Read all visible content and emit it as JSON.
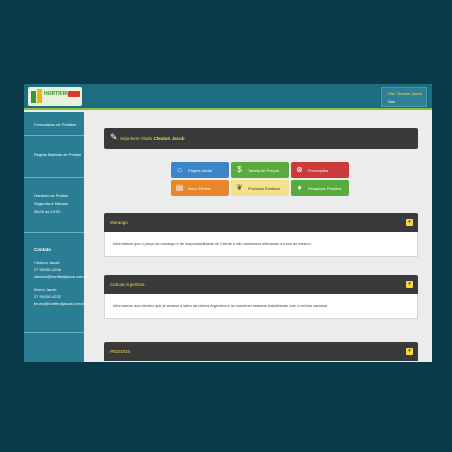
{
  "header": {
    "logo_text": "HORTIFRUTI",
    "user_name": "Olá, Cleuton Jacob",
    "user_sub": "Sair"
  },
  "sidebar": {
    "items": [
      {
        "label": "Formulários de Pedidos"
      },
      {
        "label": "Regras Básicas de Pedido"
      },
      {
        "lines": [
          "Horários de Pedido",
          "Segunda à Sábado",
          "08:00 às 13:00"
        ]
      }
    ],
    "contact": {
      "title": "Contato",
      "person1": {
        "name": "Cleuton Jacob",
        "phone": "27 99150-4246",
        "email": "cleuton@hortifrutijacob.com.br"
      },
      "person2": {
        "name": "Bruno Jacob",
        "phone": "27 99150-4232",
        "email": "bruno@hortifrutijacob.com.br"
      }
    }
  },
  "welcome": {
    "text": "Seja Bem Vindo",
    "name": "Cleuton Jacob"
  },
  "tiles": [
    {
      "label": "Página Inicial",
      "icon": "home-icon",
      "color": "#3a86c8"
    },
    {
      "label": "Tabela de Preços",
      "icon": "price-tag-icon",
      "color": "#5aab3e"
    },
    {
      "label": "Promoções",
      "icon": "percent-icon",
      "color": "#cc3a3a"
    },
    {
      "label": "Novo Pedido",
      "icon": "cart-icon",
      "color": "#e8862a"
    },
    {
      "label": "Produtos Exóticos",
      "icon": "leaf-icon",
      "color": "#f2e28a"
    },
    {
      "label": "Pesquisar Pedidos",
      "icon": "microphone-icon",
      "color": "#5aab3e"
    }
  ],
  "panels": [
    {
      "title": "Morango",
      "text": "Informamos que o preço do morango é de responsabilidade do Cliente e não estaremos efetuando a troca do mesmo."
    },
    {
      "title": "Cebola Argentina",
      "text": "Informamos aos clientes que já acabou a safra da cebola Argentina e no momento estamos trabalhando com a cebola nacional."
    },
    {
      "title": "PEDIDOS",
      "text": ""
    }
  ],
  "colors": {
    "background": "#0b3a4a",
    "topbar": "#1e6c80",
    "sidebar": "#2a7d92",
    "accent": "#86c23a",
    "panel_header": "#3a3a3a",
    "panel_title": "#f2d84a"
  }
}
